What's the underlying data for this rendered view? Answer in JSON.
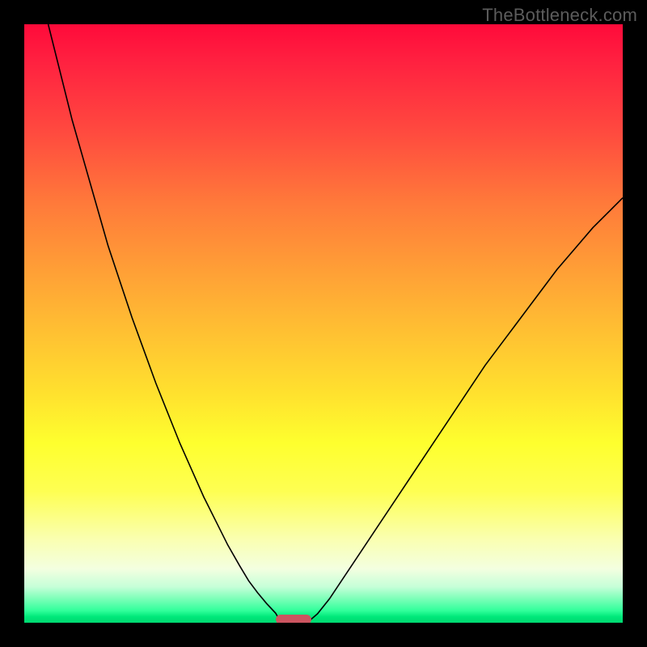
{
  "watermark": {
    "text": "TheBottleneck.com"
  },
  "chart_data": {
    "type": "line",
    "title": "",
    "xlabel": "",
    "ylabel": "",
    "xlim": [
      0,
      100
    ],
    "ylim": [
      0,
      100
    ],
    "grid": false,
    "legend": false,
    "series": [
      {
        "name": "left-curve",
        "x": [
          4.0,
          6,
          8,
          10,
          12,
          14,
          16,
          18,
          20,
          22,
          24,
          26,
          28,
          30,
          32,
          34,
          36,
          37.5,
          39,
          40.5,
          42,
          42.8
        ],
        "values": [
          100,
          92,
          84,
          77,
          70,
          63,
          57,
          51,
          45.5,
          40,
          35,
          30,
          25.5,
          21,
          17,
          13,
          9.5,
          7,
          5,
          3.2,
          1.6,
          0.2
        ]
      },
      {
        "name": "right-curve",
        "x": [
          47.5,
          49,
          51,
          53,
          56,
          59,
          62,
          65,
          68,
          71,
          74,
          77,
          80,
          83,
          86,
          89,
          92,
          95,
          98,
          100
        ],
        "values": [
          0.2,
          1.5,
          4,
          7,
          11.5,
          16,
          20.5,
          25,
          29.5,
          34,
          38.5,
          43,
          47,
          51,
          55,
          59,
          62.5,
          66,
          69,
          71
        ]
      }
    ],
    "marker": {
      "name": "optimal-range",
      "x_range": [
        42,
        48
      ],
      "y": 0.4,
      "color": "#cc5560"
    },
    "background_gradient": {
      "top": "#ff0a3a",
      "mid": "#feff2e",
      "bottom": "#00d870"
    }
  }
}
